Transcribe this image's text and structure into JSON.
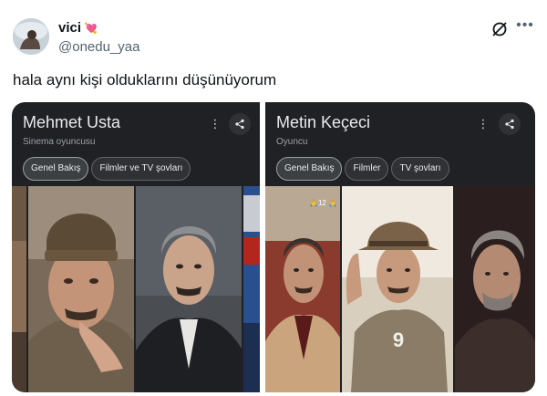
{
  "tweet": {
    "display_name": "vici",
    "handle": "@onedu_yaa",
    "text": "hala aynı kişi olduklarını düşünüyorum"
  },
  "cards": [
    {
      "title": "Mehmet Usta",
      "subtitle": "Sinema oyuncusu",
      "chips": [
        "Genel Bakış",
        "Filmler ve TV şovları"
      ]
    },
    {
      "title": "Metin Keçeci",
      "subtitle": "Oyuncu",
      "chips": [
        "Genel Bakış",
        "Filmler",
        "TV şovları"
      ],
      "photo_overlay": "🙏12 🙏"
    }
  ],
  "icons": {
    "badge": "heart-badge-icon",
    "grok": "grok-icon",
    "more": "more-icon",
    "kebab": "kebab-menu-icon",
    "share": "share-icon"
  },
  "colors": {
    "card_bg": "#202124",
    "chip_bg": "#303134",
    "text_primary": "#0f1419",
    "text_secondary": "#536471"
  }
}
